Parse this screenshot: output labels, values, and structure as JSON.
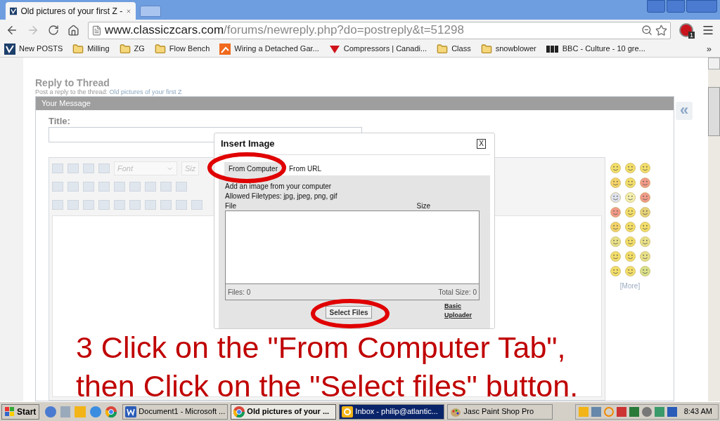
{
  "browser": {
    "tab": {
      "title": "Old pictures of your first Z -"
    },
    "address": {
      "host": "www.classiczcars.com",
      "path": "/forums/newreply.php?do=postreply&t=51298"
    },
    "extension_badge": "1",
    "bookmarks": [
      {
        "label": "New POSTS",
        "kind": "site"
      },
      {
        "label": "Milling",
        "kind": "folder"
      },
      {
        "label": "ZG",
        "kind": "folder"
      },
      {
        "label": "Flow Bench",
        "kind": "folder"
      },
      {
        "label": "Wiring a Detached Gar...",
        "kind": "orange"
      },
      {
        "label": "Compressors | Canadi...",
        "kind": "leaf"
      },
      {
        "label": "Class",
        "kind": "folder"
      },
      {
        "label": "snowblower",
        "kind": "folder"
      },
      {
        "label": "BBC - Culture - 10 gre...",
        "kind": "bbc"
      }
    ],
    "bookmarks_more": "»"
  },
  "page": {
    "heading": "Reply to Thread",
    "subheading": "Post a reply to the thread:",
    "thread_link": "Old pictures of your first Z",
    "panel_title": "Your Message",
    "title_label": "Title:",
    "editor": {
      "font": "Font",
      "size": "Siz"
    },
    "smilies_more": "[More]",
    "collapse": "«"
  },
  "dialog": {
    "title": "Insert Image",
    "close": "X",
    "tabs": [
      {
        "label": "From Computer",
        "selected": true
      },
      {
        "label": "From URL",
        "selected": false
      }
    ],
    "intro": "Add an image from your computer",
    "filetypes": "Allowed Filetypes: jpg, jpeg, png, gif",
    "columns": [
      "File",
      "Size"
    ],
    "files_count": "Files: 0",
    "total_size": "Total Size: 0",
    "select_button": "Select Files",
    "uploader_link": "Basic Uploader"
  },
  "annotation": {
    "lines": [
      "3 Click on the \"From Computer Tab\",",
      "then Click on the \"Select files\" button."
    ]
  },
  "taskbar": {
    "start": "Start",
    "tasks": [
      {
        "label": "Document1 - Microsoft ...",
        "kind": "word",
        "selected": false,
        "flashing": false
      },
      {
        "label": "Old pictures of your ...",
        "kind": "chrome",
        "selected": true,
        "flashing": false
      },
      {
        "label": "Inbox - philip@atlantic...",
        "kind": "mail",
        "selected": false,
        "flashing": true
      },
      {
        "label": "Jasc Paint Shop Pro",
        "kind": "paint",
        "selected": false,
        "flashing": false
      }
    ],
    "clock": "8:43 AM"
  }
}
